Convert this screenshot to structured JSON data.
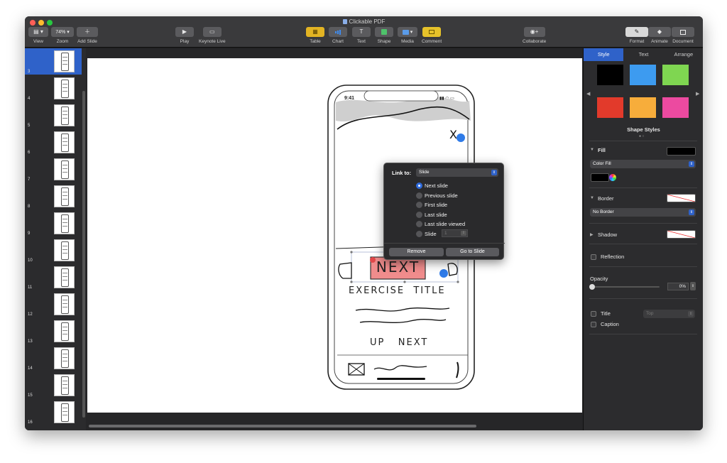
{
  "window": {
    "title": "Clickable PDF"
  },
  "toolbar": {
    "view_label": "View",
    "zoom_value": "74%",
    "zoom_label": "Zoom",
    "add_slide_label": "Add Slide",
    "play_label": "Play",
    "keynote_live_label": "Keynote Live",
    "table_label": "Table",
    "chart_label": "Chart",
    "text_label": "Text",
    "shape_label": "Shape",
    "media_label": "Media",
    "comment_label": "Comment",
    "collaborate_label": "Collaborate",
    "format_label": "Format",
    "animate_label": "Animate",
    "document_label": "Document",
    "text_glyph": "T"
  },
  "sidebar": {
    "slides": [
      "3",
      "4",
      "5",
      "6",
      "7",
      "8",
      "9",
      "10",
      "11",
      "12",
      "13",
      "14",
      "15",
      "16"
    ],
    "active_index": 0
  },
  "slide": {
    "status_time": "9:41",
    "sketch_close": "X",
    "next_button_text": "NEXT",
    "exercise_title": "EXERCISE  TITLE",
    "up_next": "UP   NEXT"
  },
  "popover": {
    "link_to_label": "Link to:",
    "link_to_value": "Slide",
    "options": [
      "Next slide",
      "Previous slide",
      "First slide",
      "Last slide",
      "Last slide viewed",
      "Slide"
    ],
    "selected_option": "Next slide",
    "slide_number": "1",
    "remove_label": "Remove",
    "go_to_slide_label": "Go to Slide"
  },
  "inspector": {
    "tabs": [
      "Style",
      "Text",
      "Arrange"
    ],
    "active_tab": "Style",
    "shape_styles_label": "Shape Styles",
    "swatch_colors": [
      "#000000",
      "#3d9bf0",
      "#7fd651",
      "#e23a2b",
      "#f7ad3b",
      "#ec4aa0"
    ],
    "fill_label": "Fill",
    "fill_color": "#000000",
    "fill_type": "Color Fill",
    "border_label": "Border",
    "border_type": "No Border",
    "shadow_label": "Shadow",
    "reflection_label": "Reflection",
    "opacity_label": "Opacity",
    "opacity_value": "0%",
    "title_label": "Title",
    "title_position": "Top",
    "caption_label": "Caption",
    "accent_color": "#2f62c9"
  }
}
